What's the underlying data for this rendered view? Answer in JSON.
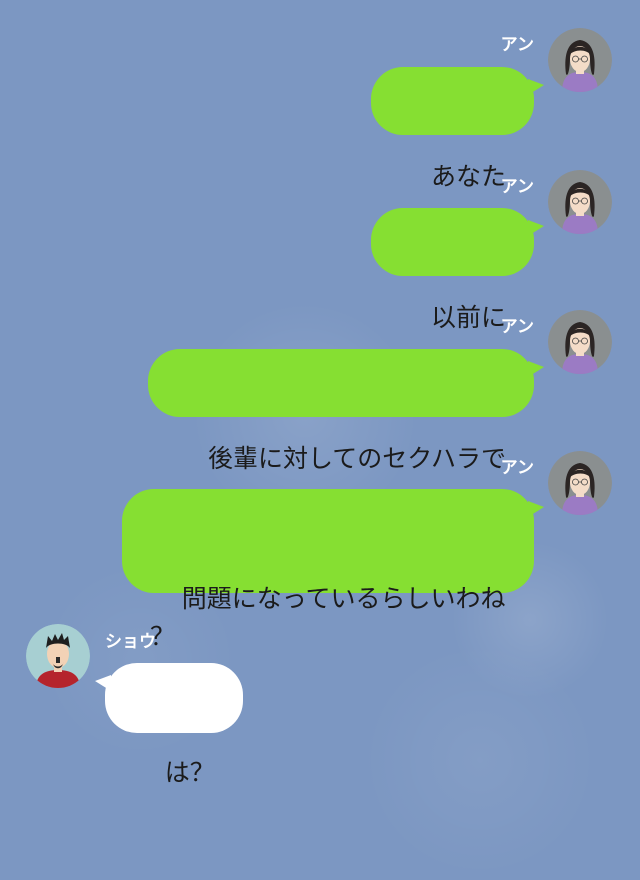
{
  "chat": {
    "messages": [
      {
        "sender": "アン",
        "text": "あなた",
        "side": "right"
      },
      {
        "sender": "アン",
        "text": "以前に",
        "side": "right"
      },
      {
        "sender": "アン",
        "text": "後輩に対してのセクハラで",
        "side": "right"
      },
      {
        "sender": "アン",
        "text": "問題になっているらしいわね\n？",
        "side": "right"
      },
      {
        "sender": "ショウ",
        "text": "は？",
        "side": "left"
      }
    ]
  },
  "colors": {
    "background": "#7c97c2",
    "outgoing_bubble": "#86df32",
    "incoming_bubble": "#ffffff",
    "name_text": "#ffffff"
  },
  "icons": [
    "woman-avatar-icon",
    "man-avatar-icon"
  ]
}
